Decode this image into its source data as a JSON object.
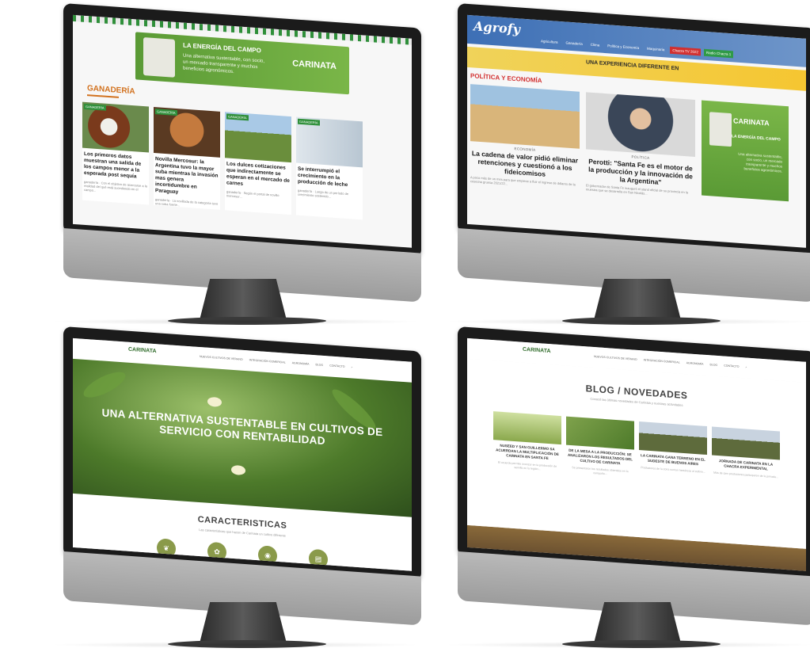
{
  "screen1": {
    "banner": {
      "title": "LA ENERGÍA DEL CAMPO",
      "subtitle": "Una alternativa sustentable, con socio, un mercado transparente y muchos beneficios agronómicos.",
      "brand": "CARINATA"
    },
    "section": "GANADERÍA",
    "cards": [
      {
        "tag": "GANADERÍA",
        "title": "Los primeros datos muestran una salida de los campos menor a la esperada post sequía",
        "text": "ganadería · Con el objetivo de acercarse a la realidad del qué está sucediendo en el campo..."
      },
      {
        "tag": "GANADERÍA",
        "title": "Novilla Mercosur: la Argentina tuvo la mayor suba mientras la invasión mas genera incertidumbre en Paraguay",
        "text": "ganadería · La novillada de la categoría tuvo una suba fuerte..."
      },
      {
        "tag": "GANADERÍA",
        "title": "Los dulces cotizaciones que indirectamente se esperan en el mercado de carnes",
        "text": "ganadería · Según el portal de novillo mercosur..."
      },
      {
        "tag": "GANADERÍA",
        "title": "Se interrumpió el crecimiento en la producción de leche",
        "text": "ganadería · Luego de un período de crecimiento sostenido..."
      }
    ]
  },
  "screen2": {
    "logo": "Agrofy",
    "nav": [
      "Agricultura",
      "Ganadería",
      "Clima",
      "Política y Economía",
      "Maquinaria"
    ],
    "nav_highlight": "Chacra TV 2022",
    "nav_highlight2": "Radio Chacra 1",
    "ad": "UNA EXPERIENCIA DIFERENTE EN",
    "section": "POLÍTICA Y ECONOMÍA",
    "articles": [
      {
        "cat": "ECONOMÍA",
        "title": "La cadena de valor pidió eliminar retenciones y cuestionó a los fideicomisos",
        "text": "A poco más de un mes para que empiece a fluir el ingreso de dólares de la cosecha gruesa 2021/22..."
      },
      {
        "cat": "POLÍTICA",
        "title": "Perotti: \"Santa Fe es el motor de la producción y la innovación de la Argentina\"",
        "text": "El gobernador de Santa Fe inauguró el stand oficial de su provincia en la muestra que se desarrolla en San Nicolás..."
      }
    ],
    "side": {
      "brand": "CARINATA",
      "slogan": "LA ENERGÍA DEL CAMPO",
      "desc": "Una alternativa sustentable, con socio, un mercado transparente y muchos beneficios agronómicos."
    }
  },
  "screen3": {
    "logo": "CARINATA",
    "menu": [
      "NUEVOS CULTIVOS DE VERANO",
      "INTEGRACIÓN COMERCIAL",
      "AGRONOMÍA",
      "BLOG",
      "CONTACTO"
    ],
    "hero": "UNA ALTERNATIVA SUSTENTABLE EN CULTIVOS DE SERVICIO CON RENTABILIDAD",
    "features_title": "CARACTERISTICAS",
    "features_sub": "Las características que hacen de Carinata un cultivo diferente"
  },
  "screen4": {
    "logo": "CARINATA",
    "menu": [
      "NUEVOS CULTIVOS DE VERANO",
      "INTEGRACIÓN COMERCIAL",
      "AGRONOMÍA",
      "BLOG",
      "CONTACTO"
    ],
    "title": "BLOG / NOVEDADES",
    "subtitle": "Conocé las últimas novedades de Carinata y nuestras actividades",
    "posts": [
      {
        "title": "NUSEED Y SAN GUILLERMO SA ACUERDAN LA MULTIPLICACIÓN DE CARINATA EN SANTA FE",
        "text": "El acuerdo permite avanzar en la producción de semilla en la región..."
      },
      {
        "title": "DE LA MESA A LA PRODUCCIÓN: SE ANALIZARON LOS RESULTADOS DEL CULTIVO DE CARINATA",
        "text": "Se presentaron los resultados obtenidos en la campaña..."
      },
      {
        "title": "LA CARINATA GANA TERRENO EN EL SUDESTE DE BUENOS AIRES",
        "text": "Productores de la zona suman hectáreas al cultivo..."
      },
      {
        "title": "JORNADA DE CARINATA EN LA CHACRA EXPERIMENTAL",
        "text": "Más de cien productores participaron de la jornada..."
      }
    ]
  }
}
